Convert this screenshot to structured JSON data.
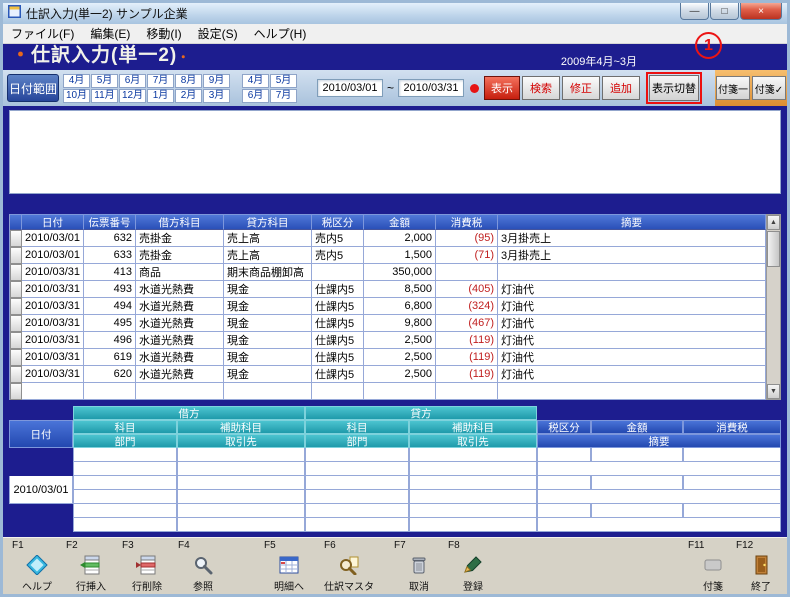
{
  "window": {
    "title": "仕訳入力(単一2) サンプル企業",
    "controls": {
      "minimize": "—",
      "maximize": "□",
      "close": "×"
    }
  },
  "menu": {
    "items": [
      "ファイル(F)",
      "編集(E)",
      "移動(I)",
      "設定(S)",
      "ヘルプ(H)"
    ]
  },
  "banner": {
    "bullet": "・",
    "title": "仕訳入力(単一2)",
    "period": "2009年4月~3月"
  },
  "toolbar": {
    "date_range": "日付範囲",
    "months_main": [
      "4月",
      "5月",
      "6月",
      "7月",
      "8月",
      "9月",
      "10月",
      "11月",
      "12月",
      "1月",
      "2月",
      "3月"
    ],
    "months_sub": [
      "4月",
      "5月",
      "6月",
      "7月"
    ],
    "date_from": "2010/03/01",
    "tilde": "~",
    "date_to": "2010/03/31",
    "display": "表示",
    "search": "検索",
    "modify": "修正",
    "add": "追加",
    "view_toggle": "表示切替",
    "fusen_list": "付箋一",
    "fusen_check": "付箋✓"
  },
  "annotation": {
    "label": "1"
  },
  "table": {
    "headers": [
      "日付",
      "伝票番号",
      "借方科目",
      "貸方科目",
      "税区分",
      "金額",
      "消費税",
      "摘要"
    ],
    "scrollbar": {
      "up": "▲",
      "down": "▼"
    },
    "rows": [
      {
        "date": "2010/03/01",
        "no": "632",
        "debit": "売掛金",
        "credit": "売上高",
        "tax_class": "売内5",
        "amount": "2,000",
        "tax": "(95)",
        "memo": "3月掛売上"
      },
      {
        "date": "2010/03/01",
        "no": "633",
        "debit": "売掛金",
        "credit": "売上高",
        "tax_class": "売内5",
        "amount": "1,500",
        "tax": "(71)",
        "memo": "3月掛売上"
      },
      {
        "date": "2010/03/31",
        "no": "413",
        "debit": "商品",
        "credit": "期末商品棚卸高",
        "tax_class": "",
        "amount": "350,000",
        "tax": "",
        "memo": ""
      },
      {
        "date": "2010/03/31",
        "no": "493",
        "debit": "水道光熱費",
        "credit": "現金",
        "tax_class": "仕課内5",
        "amount": "8,500",
        "tax": "(405)",
        "memo": "灯油代"
      },
      {
        "date": "2010/03/31",
        "no": "494",
        "debit": "水道光熱費",
        "credit": "現金",
        "tax_class": "仕課内5",
        "amount": "6,800",
        "tax": "(324)",
        "memo": "灯油代"
      },
      {
        "date": "2010/03/31",
        "no": "495",
        "debit": "水道光熱費",
        "credit": "現金",
        "tax_class": "仕課内5",
        "amount": "9,800",
        "tax": "(467)",
        "memo": "灯油代"
      },
      {
        "date": "2010/03/31",
        "no": "496",
        "debit": "水道光熱費",
        "credit": "現金",
        "tax_class": "仕課内5",
        "amount": "2,500",
        "tax": "(119)",
        "memo": "灯油代"
      },
      {
        "date": "2010/03/31",
        "no": "619",
        "debit": "水道光熱費",
        "credit": "現金",
        "tax_class": "仕課内5",
        "amount": "2,500",
        "tax": "(119)",
        "memo": "灯油代"
      },
      {
        "date": "2010/03/31",
        "no": "620",
        "debit": "水道光熱費",
        "credit": "現金",
        "tax_class": "仕課内5",
        "amount": "2,500",
        "tax": "(119)",
        "memo": "灯油代"
      },
      {
        "date": "",
        "no": "",
        "debit": "",
        "credit": "",
        "tax_class": "",
        "amount": "",
        "tax": "",
        "memo": ""
      }
    ]
  },
  "form": {
    "debit": "借方",
    "credit": "貸方",
    "date": "日付",
    "subject": "科目",
    "sub_subject": "補助科目",
    "department": "部門",
    "partner": "取引先",
    "tax_class": "税区分",
    "amount": "金額",
    "tax": "消費税",
    "memo": "摘要",
    "entry_date": "2010/03/01"
  },
  "fnbar": {
    "items": [
      {
        "key": "F1",
        "label": "ヘルプ",
        "icon": "help-icon"
      },
      {
        "key": "F2",
        "label": "行挿入",
        "icon": "row-insert-icon"
      },
      {
        "key": "F3",
        "label": "行削除",
        "icon": "row-delete-icon"
      },
      {
        "key": "F4",
        "label": "参照",
        "icon": "reference-icon"
      },
      {
        "key": "F5",
        "label": "明細へ",
        "icon": "detail-icon"
      },
      {
        "key": "F6",
        "label": "仕訳マスタ",
        "icon": "journal-master-icon"
      },
      {
        "key": "F7",
        "label": "取消",
        "icon": "cancel-icon"
      },
      {
        "key": "F8",
        "label": "登録",
        "icon": "register-icon"
      },
      {
        "key": "F11",
        "label": "付箋",
        "icon": "sticky-note-icon"
      },
      {
        "key": "F12",
        "label": "終了",
        "icon": "exit-icon"
      }
    ]
  }
}
